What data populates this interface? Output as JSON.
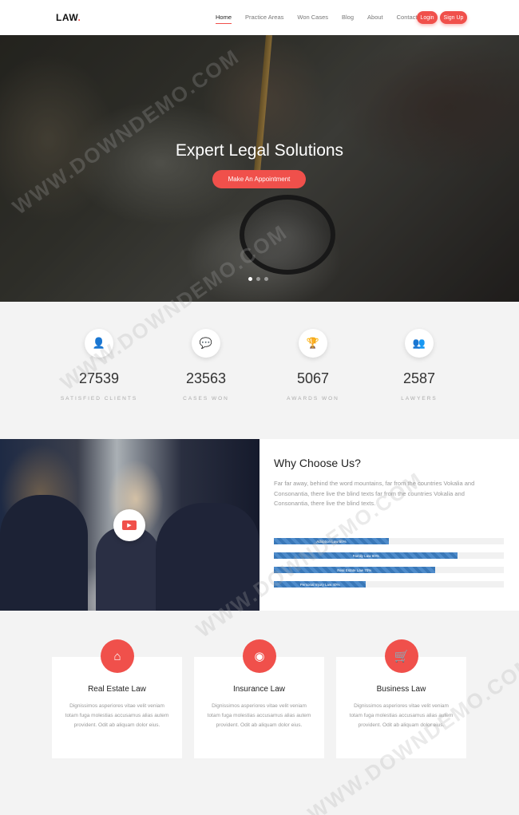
{
  "header": {
    "logo": "LAW",
    "logo_dot": ".",
    "menu": [
      {
        "label": "Home",
        "active": true
      },
      {
        "label": "Practice Areas"
      },
      {
        "label": "Won Cases"
      },
      {
        "label": "Blog"
      },
      {
        "label": "About"
      },
      {
        "label": "Contact"
      }
    ],
    "login_label": "Login",
    "signup_label": "Sign Up"
  },
  "hero": {
    "title": "Expert Legal Solutions",
    "cta_label": "Make An Appointment",
    "slides": 3,
    "active_slide": 1
  },
  "stats": [
    {
      "icon": "user-icon",
      "glyph": "👤",
      "value": "27539",
      "label": "SATISFIED CLIENTS"
    },
    {
      "icon": "chat-icon",
      "glyph": "💬",
      "value": "23563",
      "label": "CASES WON"
    },
    {
      "icon": "trophy-icon",
      "glyph": "🏆",
      "value": "5067",
      "label": "AWARDS WON"
    },
    {
      "icon": "users-icon",
      "glyph": "👥",
      "value": "2587",
      "label": "LAWYERS"
    }
  ],
  "why": {
    "title": "Why Choose Us?",
    "text": "Far far away, behind the word mountains, far from the countries Vokalia and Consonantia, there live the blind texts far from the countries Vokalia and Consonantia, there live the blind texts.",
    "bars": [
      {
        "label": "Adoption Law 50%",
        "percent": 50
      },
      {
        "label": "Family Law 80%",
        "percent": 80
      },
      {
        "label": "Real Estate Law 70%",
        "percent": 70
      },
      {
        "label": "Personal Injury Law 40%",
        "percent": 40
      }
    ]
  },
  "services": [
    {
      "icon": "home-icon",
      "glyph": "⌂",
      "title": "Real Estate Law",
      "desc": "Dignissimos asperiores vitae velit veniam totam fuga molestias accusamus alias autem provident. Odit ab aliquam dolor eius."
    },
    {
      "icon": "eye-icon",
      "glyph": "◉",
      "title": "Insurance Law",
      "desc": "Dignissimos asperiores vitae velit veniam totam fuga molestias accusamus alias autem provident. Odit ab aliquam dolor eius."
    },
    {
      "icon": "cart-icon",
      "glyph": "🛒",
      "title": "Business Law",
      "desc": "Dignissimos asperiores vitae velit veniam totam fuga molestias accusamus alias autem provident. Odit ab aliquam dolor eius."
    }
  ],
  "watermark": "WWW.DOWNDEMO.COM",
  "colors": {
    "accent": "#f0504b",
    "bar": "#3a78b8"
  }
}
